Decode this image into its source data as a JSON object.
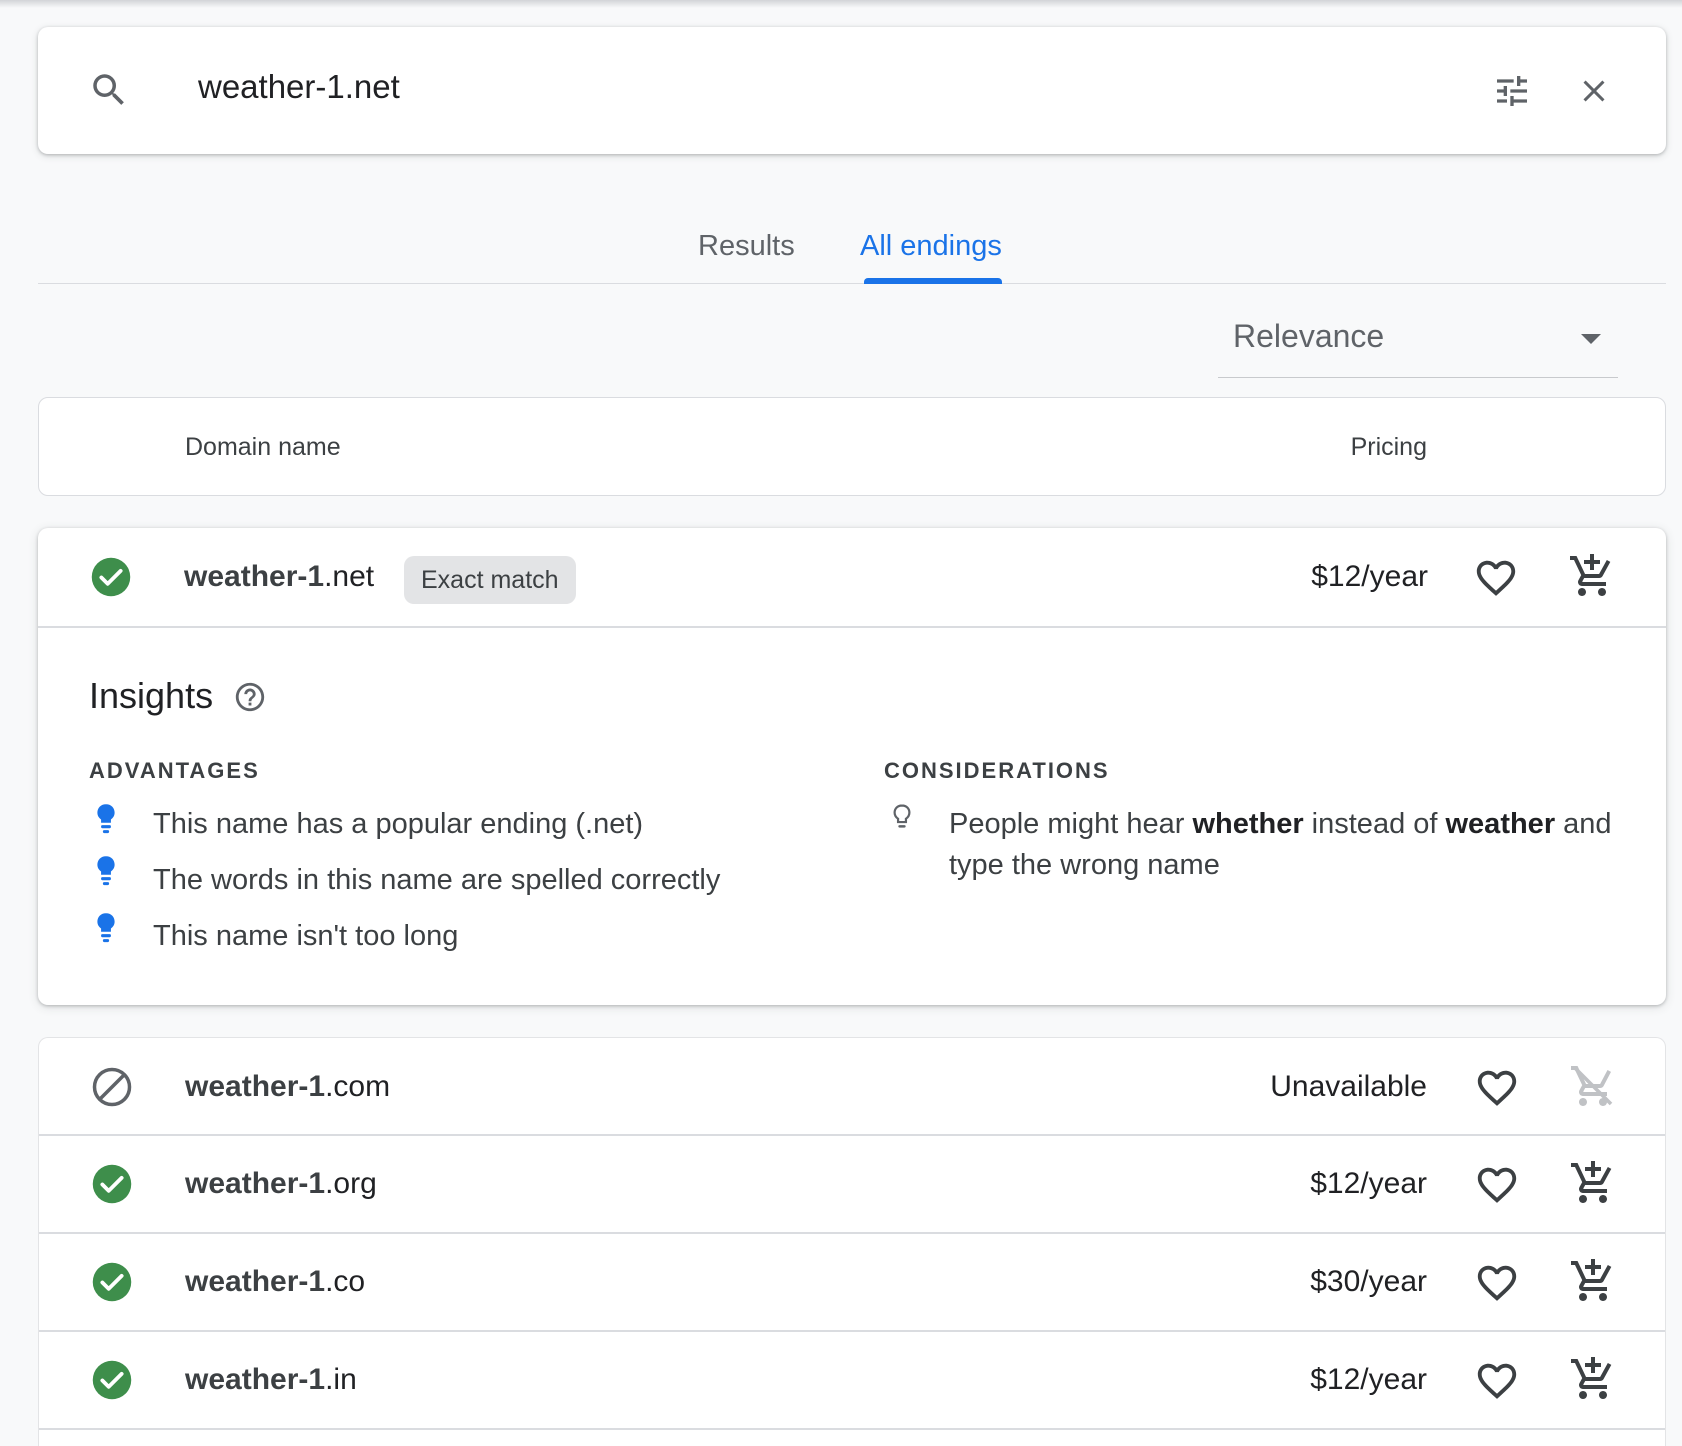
{
  "search": {
    "query": "weather-1.net",
    "icons": [
      "search-icon",
      "tune-icon",
      "close-icon"
    ]
  },
  "tabs": [
    {
      "label": "Results",
      "active": false
    },
    {
      "label": "All endings",
      "active": true
    }
  ],
  "sort": {
    "selected": "Relevance"
  },
  "table_header": {
    "domain": "Domain name",
    "pricing": "Pricing"
  },
  "featured": {
    "name": "weather-1",
    "ending": ".net",
    "badge": "Exact match",
    "price": "$12/year",
    "status": "available",
    "insights": {
      "title": "Insights",
      "advantages_title": "ADVANTAGES",
      "advantages": [
        "This name has a popular ending (.net)",
        "The words in this name are spelled correctly",
        "This name isn't too long"
      ],
      "considerations_title": "CONSIDERATIONS",
      "consideration": {
        "part1": "People might hear ",
        "bold1": "whether",
        "part2": " instead of ",
        "bold2": "weather",
        "part3": " and",
        "line2": "type the wrong name"
      }
    }
  },
  "results": [
    {
      "name": "weather-1",
      "ending": ".com",
      "price": "Unavailable",
      "status": "unavailable"
    },
    {
      "name": "weather-1",
      "ending": ".org",
      "price": "$12/year",
      "status": "available"
    },
    {
      "name": "weather-1",
      "ending": ".co",
      "price": "$30/year",
      "status": "available"
    },
    {
      "name": "weather-1",
      "ending": ".in",
      "price": "$12/year",
      "status": "available"
    }
  ],
  "colors": {
    "accent": "#1a73e8",
    "available": "#34a853",
    "text": "#202124",
    "muted": "#5f6368",
    "badge_bg": "#e3e4e6"
  }
}
